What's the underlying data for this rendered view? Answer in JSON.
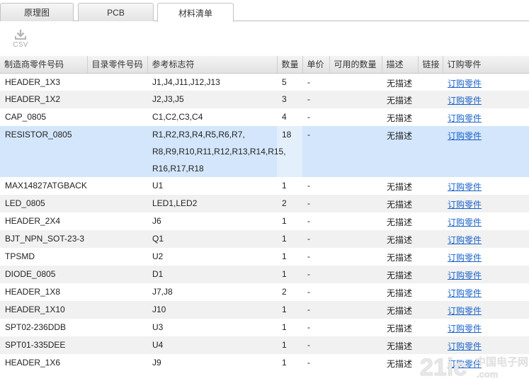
{
  "tabs": [
    {
      "label": "原理图",
      "active": false
    },
    {
      "label": "PCB",
      "active": false
    },
    {
      "label": "材料清单",
      "active": true
    }
  ],
  "toolbar": {
    "csv_label": "CSV",
    "csv_icon": "download-icon"
  },
  "columns": [
    "制造商零件号码",
    "目录零件号码",
    "参考标志符",
    "数量",
    "单价",
    "可用的数量",
    "描述",
    "链接",
    "订购零件"
  ],
  "rows": [
    {
      "mfr": "HEADER_1X3",
      "catalog": "",
      "refs": "J1,J4,J11,J12,J13",
      "qty": "5",
      "price": "-",
      "avail": "",
      "desc": "无描述",
      "link": "",
      "order": "订购零件"
    },
    {
      "mfr": "HEADER_1X2",
      "catalog": "",
      "refs": "J2,J3,J5",
      "qty": "3",
      "price": "-",
      "avail": "",
      "desc": "无描述",
      "link": "",
      "order": "订购零件"
    },
    {
      "mfr": "CAP_0805",
      "catalog": "",
      "refs": "C1,C2,C3,C4",
      "qty": "4",
      "price": "-",
      "avail": "",
      "desc": "无描述",
      "link": "",
      "order": "订购零件"
    },
    {
      "mfr": "RESISTOR_0805",
      "catalog": "",
      "refs": "R1,R2,R3,R4,R5,R6,R7, R8,R9,R10,R11,R12,R13,R14,R15, R16,R17,R18",
      "qty": "18",
      "price": "-",
      "avail": "",
      "desc": "无描述",
      "link": "",
      "order": "订购零件"
    },
    {
      "mfr": "MAX14827ATGBACK",
      "catalog": "",
      "refs": "U1",
      "qty": "1",
      "price": "-",
      "avail": "",
      "desc": "无描述",
      "link": "",
      "order": "订购零件"
    },
    {
      "mfr": "LED_0805",
      "catalog": "",
      "refs": "LED1,LED2",
      "qty": "2",
      "price": "-",
      "avail": "",
      "desc": "无描述",
      "link": "",
      "order": "订购零件"
    },
    {
      "mfr": "HEADER_2X4",
      "catalog": "",
      "refs": "J6",
      "qty": "1",
      "price": "-",
      "avail": "",
      "desc": "无描述",
      "link": "",
      "order": "订购零件"
    },
    {
      "mfr": "BJT_NPN_SOT-23-3",
      "catalog": "",
      "refs": "Q1",
      "qty": "1",
      "price": "-",
      "avail": "",
      "desc": "无描述",
      "link": "",
      "order": "订购零件"
    },
    {
      "mfr": "TPSMD",
      "catalog": "",
      "refs": "U2",
      "qty": "1",
      "price": "-",
      "avail": "",
      "desc": "无描述",
      "link": "",
      "order": "订购零件"
    },
    {
      "mfr": "DIODE_0805",
      "catalog": "",
      "refs": "D1",
      "qty": "1",
      "price": "-",
      "avail": "",
      "desc": "无描述",
      "link": "",
      "order": "订购零件"
    },
    {
      "mfr": "HEADER_1X8",
      "catalog": "",
      "refs": "J7,J8",
      "qty": "2",
      "price": "-",
      "avail": "",
      "desc": "无描述",
      "link": "",
      "order": "订购零件"
    },
    {
      "mfr": "HEADER_1X10",
      "catalog": "",
      "refs": "J10",
      "qty": "1",
      "price": "-",
      "avail": "",
      "desc": "无描述",
      "link": "",
      "order": "订购零件"
    },
    {
      "mfr": "SPT02-236DDB",
      "catalog": "",
      "refs": "U3",
      "qty": "1",
      "price": "-",
      "avail": "",
      "desc": "无描述",
      "link": "",
      "order": "订购零件"
    },
    {
      "mfr": "SPT01-335DEE",
      "catalog": "",
      "refs": "U4",
      "qty": "1",
      "price": "-",
      "avail": "",
      "desc": "无描述",
      "link": "",
      "order": "订购零件"
    },
    {
      "mfr": "HEADER_1X6",
      "catalog": "",
      "refs": "J9",
      "qty": "1",
      "price": "-",
      "avail": "",
      "desc": "无描述",
      "link": "",
      "order": "订购零件"
    }
  ],
  "selected_row": 3,
  "colors": {
    "selected_row": "#d4e6fb",
    "link": "#1a63c9",
    "alt_row": "#f1f1f1"
  }
}
